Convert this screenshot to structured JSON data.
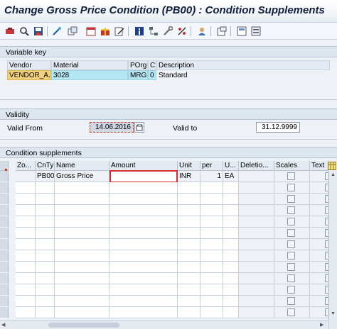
{
  "title": "Change Gross Price Condition (PB00) : Condition Supplements",
  "toolbar": {
    "icons": [
      "expand-icon",
      "find-icon",
      "save-local-icon",
      "wand-icon",
      "copy-icon",
      "calendar-icon",
      "gift-icon",
      "edit-icon",
      "info-icon",
      "structure-icon",
      "tools-icon",
      "percent-icon",
      "user-icon",
      "new-window-icon",
      "layout-icon",
      "options-icon"
    ]
  },
  "variable_key": {
    "group_title": "Variable key",
    "headers": [
      "Vendor",
      "Material",
      "POrg",
      "C",
      "Description"
    ],
    "row": [
      "VENDOR_A...",
      "3028",
      "MRG",
      "0",
      "Standard"
    ]
  },
  "validity": {
    "group_title": "Validity",
    "valid_from_label": "Valid From",
    "valid_from_value": "14.06.2016",
    "valid_to_label": "Valid to",
    "valid_to_value": "31.12.9999"
  },
  "condition_supplements": {
    "group_title": "Condition supplements",
    "columns": [
      "Zo...",
      "CnTy",
      "Name",
      "Amount",
      "Unit",
      "per",
      "U...",
      "Deletio...",
      "Scales",
      "Text"
    ],
    "rows": [
      {
        "zo": "",
        "cnty": "PB00",
        "name": "Gross Price",
        "amount": "",
        "unit": "INR",
        "per": "1",
        "uom": "EA"
      }
    ],
    "empty_rows": 12
  }
}
